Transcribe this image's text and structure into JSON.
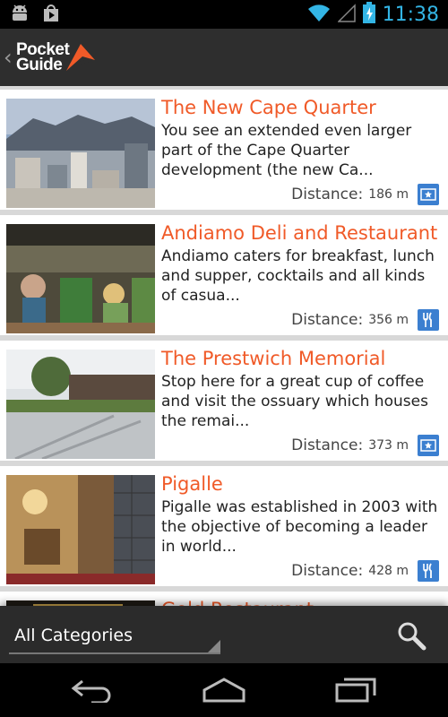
{
  "status_bar": {
    "time": "11:38",
    "icons": [
      "android-debug-icon",
      "play-store-icon",
      "wifi-icon",
      "signal-icon",
      "battery-charging-icon"
    ]
  },
  "action_bar": {
    "logo_line1": "Pocket",
    "logo_line2": "Guide",
    "accent_color": "#f05a28"
  },
  "places": [
    {
      "title": "The New Cape Quarter",
      "description": "You see an extended even larger part of the Cape Quarter development (the new Ca...",
      "distance_label": "Distance:",
      "distance_value": "186 m",
      "category_icon": "sight-icon"
    },
    {
      "title": "Andiamo Deli and Restaurant",
      "description": "Andiamo caters for breakfast, lunch and supper, cocktails and all kinds of casua...",
      "distance_label": "Distance:",
      "distance_value": "356 m",
      "category_icon": "restaurant-icon"
    },
    {
      "title": "The Prestwich Memorial",
      "description": "Stop here for a great cup of coffee and visit the ossuary which houses the remai...",
      "distance_label": "Distance:",
      "distance_value": "373 m",
      "category_icon": "sight-icon"
    },
    {
      "title": "Pigalle",
      "description": "Pigalle was established in 2003 with the objective of becoming a leader in world...",
      "distance_label": "Distance:",
      "distance_value": "428 m",
      "category_icon": "restaurant-icon"
    },
    {
      "title": "Gold Restaurant"
    }
  ],
  "bottom_bar": {
    "category_selected": "All Categories",
    "search_icon": "search-icon"
  },
  "nav_bar": {
    "icons": [
      "back-icon",
      "home-icon",
      "recent-apps-icon"
    ]
  }
}
